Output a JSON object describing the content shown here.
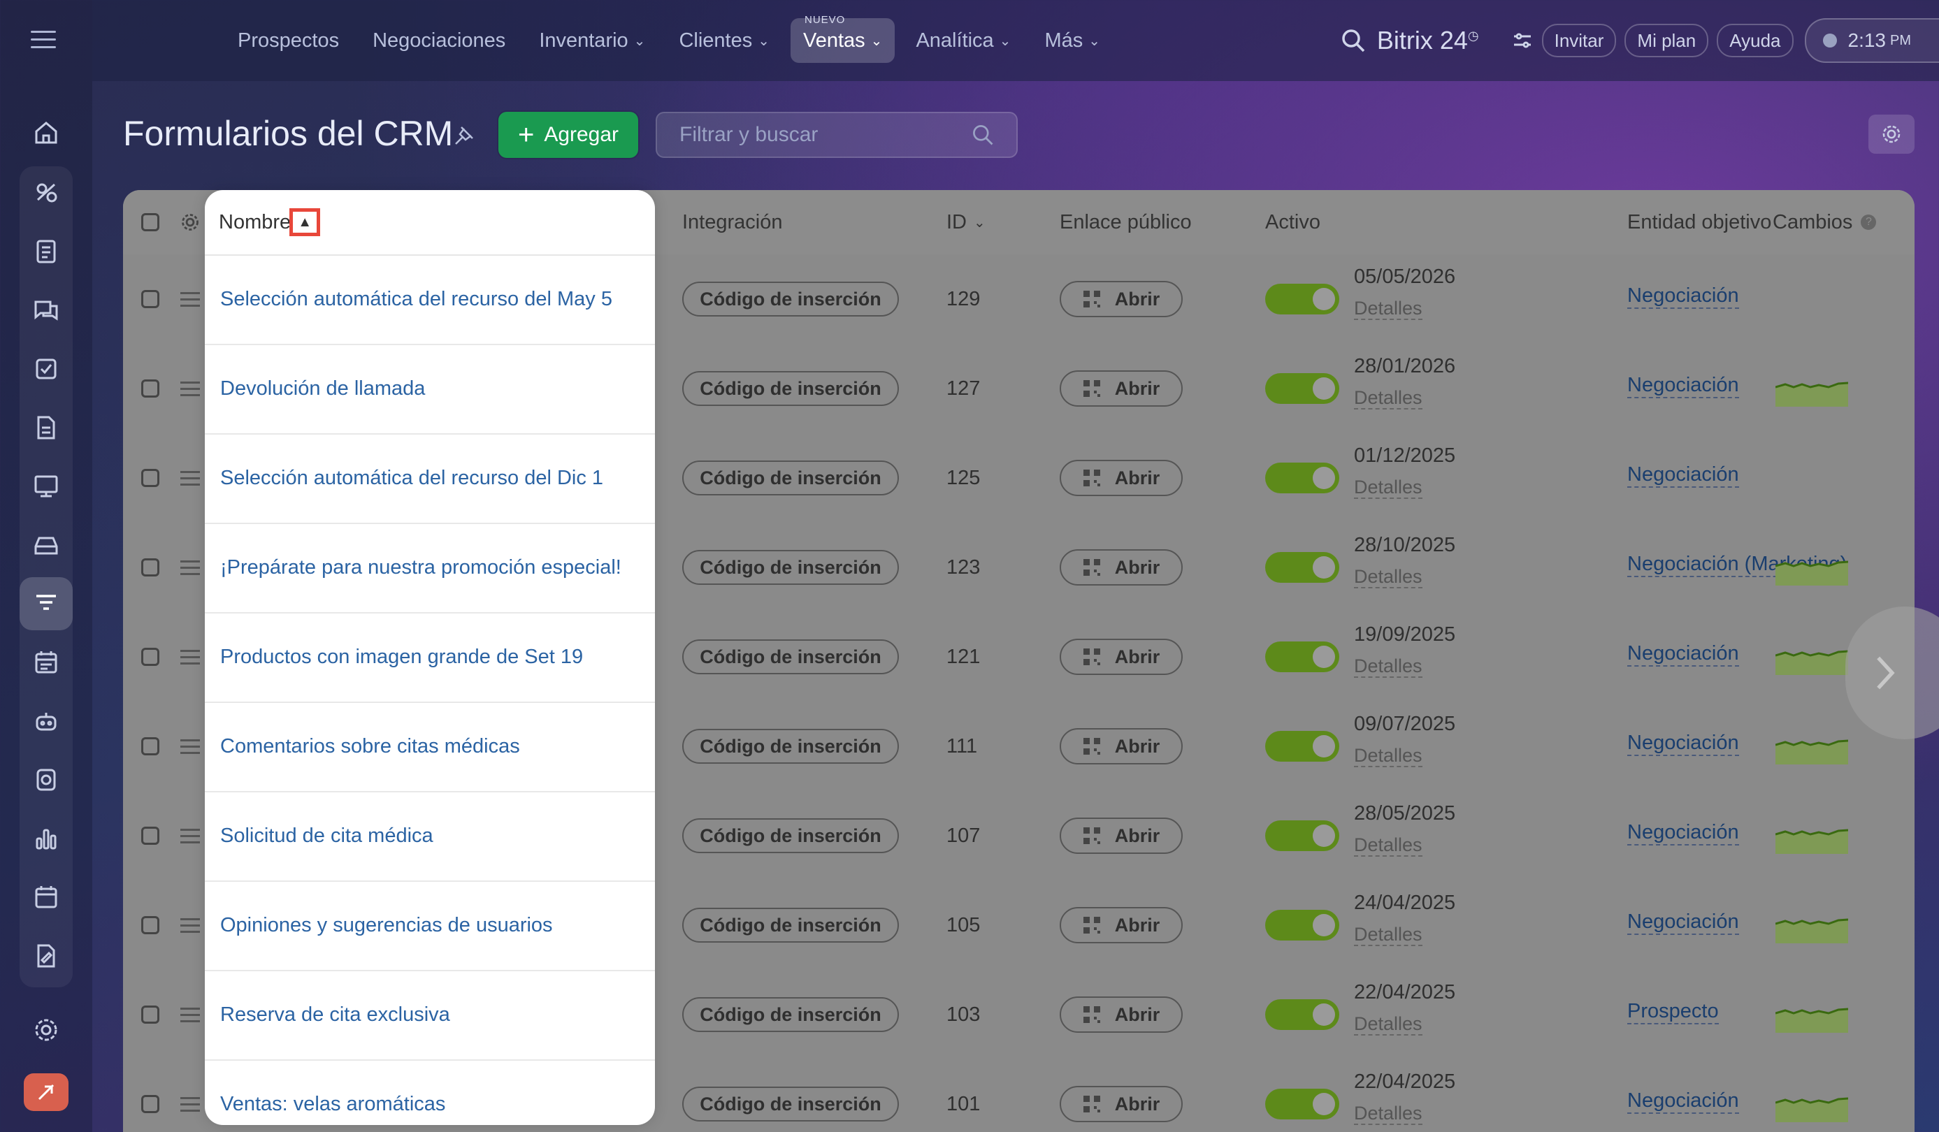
{
  "topnav": {
    "items": [
      {
        "label": "Prospectos",
        "chevron": false
      },
      {
        "label": "Negociaciones",
        "chevron": false
      },
      {
        "label": "Inventario",
        "chevron": true
      },
      {
        "label": "Clientes",
        "chevron": true
      },
      {
        "label": "Ventas",
        "chevron": true,
        "badge": "NUEVO",
        "active": true
      },
      {
        "label": "Analítica",
        "chevron": true
      },
      {
        "label": "Más",
        "chevron": true
      }
    ],
    "brand": "Bitrix 24",
    "invite": "Invitar",
    "plan": "Mi plan",
    "help": "Ayuda",
    "time": "2:13",
    "ampm": "PM"
  },
  "header": {
    "title": "Formularios del CRM",
    "add_label": "Agregar",
    "search_placeholder": "Filtrar y buscar"
  },
  "columns": {
    "name": "Nombre",
    "integration": "Integración",
    "id": "ID",
    "public_link": "Enlace público",
    "active": "Activo",
    "target": "Entidad objetivo",
    "changes": "Cambios"
  },
  "rows": [
    {
      "name": "Selección automática del recurso del May 5",
      "integration": "Código de inserción",
      "id": "129",
      "link": "Abrir",
      "date": "05/05/2026",
      "details": "Detalles",
      "entity": "Negociación",
      "spark": false
    },
    {
      "name": "Devolución de llamada",
      "integration": "Código de inserción",
      "id": "127",
      "link": "Abrir",
      "date": "28/01/2026",
      "details": "Detalles",
      "entity": "Negociación",
      "spark": true
    },
    {
      "name": "Selección automática del recurso del Dic 1",
      "integration": "Código de inserción",
      "id": "125",
      "link": "Abrir",
      "date": "01/12/2025",
      "details": "Detalles",
      "entity": "Negociación",
      "spark": false
    },
    {
      "name": "¡Prepárate para nuestra promoción especial!",
      "integration": "Código de inserción",
      "id": "123",
      "link": "Abrir",
      "date": "28/10/2025",
      "details": "Detalles",
      "entity": "Negociación (Marketing)",
      "spark": true
    },
    {
      "name": "Productos con imagen grande de Set 19",
      "integration": "Código de inserción",
      "id": "121",
      "link": "Abrir",
      "date": "19/09/2025",
      "details": "Detalles",
      "entity": "Negociación",
      "spark": true
    },
    {
      "name": "Comentarios sobre citas médicas",
      "integration": "Código de inserción",
      "id": "111",
      "link": "Abrir",
      "date": "09/07/2025",
      "details": "Detalles",
      "entity": "Negociación",
      "spark": true
    },
    {
      "name": "Solicitud de cita médica",
      "integration": "Código de inserción",
      "id": "107",
      "link": "Abrir",
      "date": "28/05/2025",
      "details": "Detalles",
      "entity": "Negociación",
      "spark": true
    },
    {
      "name": "Opiniones y sugerencias de usuarios",
      "integration": "Código de inserción",
      "id": "105",
      "link": "Abrir",
      "date": "24/04/2025",
      "details": "Detalles",
      "entity": "Negociación",
      "spark": true
    },
    {
      "name": "Reserva de cita exclusiva",
      "integration": "Código de inserción",
      "id": "103",
      "link": "Abrir",
      "date": "22/04/2025",
      "details": "Detalles",
      "entity": "Prospecto",
      "spark": true
    },
    {
      "name": "Ventas: velas aromáticas",
      "integration": "Código de inserción",
      "id": "101",
      "link": "Abrir",
      "date": "22/04/2025",
      "details": "Detalles",
      "entity": "Negociación",
      "spark": true
    }
  ],
  "colors": {
    "accent_green": "#1a9a50",
    "toggle_on": "#5d8a1a",
    "link_blue": "#2b63a3",
    "highlight_red": "#e8473a"
  }
}
